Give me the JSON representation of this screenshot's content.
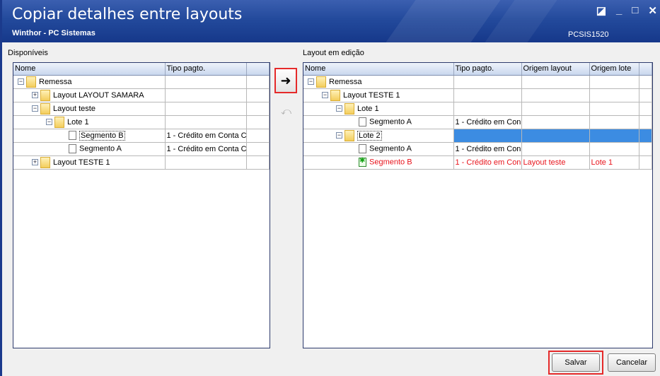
{
  "window": {
    "title": "Copiar detalhes entre layouts",
    "subtitle": "Winthor - PC Sistemas",
    "code": "PCSIS1520",
    "controls": [
      "◪",
      "_",
      "□",
      "✕"
    ]
  },
  "left_panel": {
    "label": "Disponíveis",
    "columns": [
      "Nome",
      "Tipo pagto."
    ],
    "rows": [
      {
        "level": 0,
        "expander": "−",
        "icon": "folder",
        "name": "Remessa",
        "tipo": ""
      },
      {
        "level": 1,
        "expander": "+",
        "icon": "folder",
        "name": "Layout LAYOUT SAMARA",
        "tipo": ""
      },
      {
        "level": 1,
        "expander": "−",
        "icon": "folder",
        "name": "Layout teste",
        "tipo": ""
      },
      {
        "level": 2,
        "expander": "−",
        "icon": "folder",
        "name": "Lote 1",
        "tipo": ""
      },
      {
        "level": 3,
        "expander": "",
        "icon": "doc",
        "name": "Segmento B",
        "tipo": "1 - Crédito em Conta C"
      },
      {
        "level": 3,
        "expander": "",
        "icon": "doc",
        "name": "Segmento A",
        "tipo": "1 - Crédito em Conta C"
      },
      {
        "level": 1,
        "expander": "+",
        "icon": "folder",
        "name": "Layout TESTE 1",
        "tipo": ""
      }
    ]
  },
  "right_panel": {
    "label": "Layout em edição",
    "columns": [
      "Nome",
      "Tipo pagto.",
      "Origem layout",
      "Origem lote"
    ],
    "rows": [
      {
        "level": 0,
        "expander": "−",
        "icon": "folder",
        "name": "Remessa",
        "tipo": "",
        "origem_layout": "",
        "origem_lote": ""
      },
      {
        "level": 1,
        "expander": "−",
        "icon": "folder",
        "name": "Layout TESTE 1",
        "tipo": "",
        "origem_layout": "",
        "origem_lote": ""
      },
      {
        "level": 2,
        "expander": "−",
        "icon": "folder",
        "name": "Lote 1",
        "tipo": "",
        "origem_layout": "",
        "origem_lote": ""
      },
      {
        "level": 3,
        "expander": "",
        "icon": "doc",
        "name": "Segmento A",
        "tipo": "1 - Crédito em Con",
        "origem_layout": "",
        "origem_lote": ""
      },
      {
        "level": 2,
        "expander": "−",
        "icon": "folder",
        "name": "Lote 2",
        "tipo": "",
        "origem_layout": "",
        "origem_lote": "",
        "selected": true
      },
      {
        "level": 3,
        "expander": "",
        "icon": "doc",
        "name": "Segmento A",
        "tipo": "1 - Crédito em Con",
        "origem_layout": "",
        "origem_lote": ""
      },
      {
        "level": 3,
        "expander": "",
        "icon": "doc-new",
        "name": "Segmento B",
        "tipo": "1 - Crédito em Con",
        "origem_layout": "Layout teste",
        "origem_lote": "Lote 1",
        "highlight": true
      }
    ]
  },
  "buttons": {
    "copy": "➜",
    "back": "⤺",
    "save": "Salvar",
    "cancel": "Cancelar"
  },
  "colors": {
    "title_bar": "#234a9c",
    "selection": "#3c8ce2",
    "highlight_text": "#e8141c",
    "callout_border": "#e52a2a"
  }
}
